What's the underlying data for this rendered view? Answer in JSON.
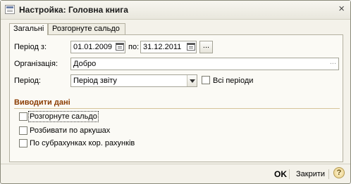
{
  "window": {
    "title": "Настройка: Головна книга",
    "close_glyph": "×"
  },
  "tabs": [
    {
      "label": "Загальні",
      "active": true
    },
    {
      "label": "Розгорнуте сальдо",
      "active": false
    }
  ],
  "form": {
    "period_label": "Період з:",
    "period_from": "01.01.2009",
    "period_to_label": "по:",
    "period_to": "31.12.2011",
    "dots_glyph": "...",
    "organization_label": "Організація:",
    "organization_value": "Добро",
    "organization_dots": "...",
    "period_type_label": "Період:",
    "period_type_value": "Період звіту",
    "all_periods_label": "Всі періоди",
    "all_periods_checked": false
  },
  "output": {
    "section_title": "Виводити дані",
    "options": [
      {
        "label": "Розгорнуте сальдо",
        "checked": false,
        "focused": true
      },
      {
        "label": "Розбивати по аркушах",
        "checked": false,
        "focused": false
      },
      {
        "label": "По субрахунках кор. рахунків",
        "checked": false,
        "focused": false
      }
    ]
  },
  "footer": {
    "ok_label": "OK",
    "close_label": "Закрити",
    "help_glyph": "?"
  },
  "icons": [
    "window-form-icon",
    "close-icon",
    "calendar-icon",
    "chevron-down-icon",
    "help-icon"
  ]
}
